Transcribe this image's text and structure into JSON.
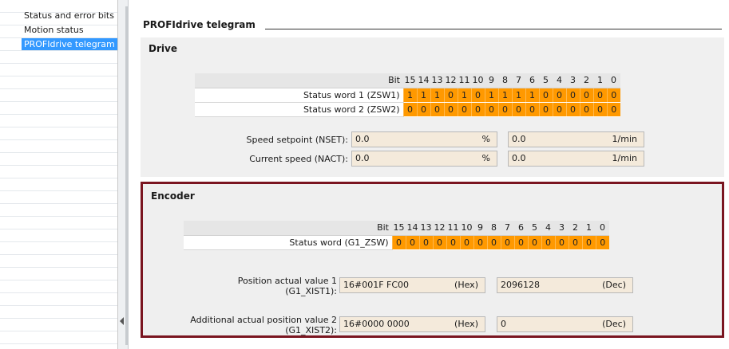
{
  "nav": {
    "items": [
      {
        "label": "Status and error bits",
        "selected": false
      },
      {
        "label": "Motion status",
        "selected": false
      },
      {
        "label": "PROFIdrive telegram",
        "selected": true
      }
    ]
  },
  "page": {
    "title": "PROFIdrive telegram"
  },
  "drive": {
    "title": "Drive",
    "bit_header_label": "Bit",
    "bit_numbers": [
      "15",
      "14",
      "13",
      "12",
      "11",
      "10",
      "9",
      "8",
      "7",
      "6",
      "5",
      "4",
      "3",
      "2",
      "1",
      "0"
    ],
    "rows": [
      {
        "label": "Status word 1 (ZSW1)",
        "bits": [
          "1",
          "1",
          "1",
          "0",
          "1",
          "0",
          "1",
          "1",
          "1",
          "1",
          "0",
          "0",
          "0",
          "0",
          "0",
          "0"
        ]
      },
      {
        "label": "Status word 2 (ZSW2)",
        "bits": [
          "0",
          "0",
          "0",
          "0",
          "0",
          "0",
          "0",
          "0",
          "0",
          "0",
          "0",
          "0",
          "0",
          "0",
          "0",
          "0"
        ]
      }
    ],
    "speed_setpoint": {
      "label": "Speed setpoint (NSET):",
      "percent_value": "0.0",
      "percent_unit": "%",
      "rpm_value": "0.0",
      "rpm_unit": "1/min"
    },
    "current_speed": {
      "label": "Current speed (NACT):",
      "percent_value": "0.0",
      "percent_unit": "%",
      "rpm_value": "0.0",
      "rpm_unit": "1/min"
    }
  },
  "encoder": {
    "title": "Encoder",
    "bit_header_label": "Bit",
    "bit_numbers": [
      "15",
      "14",
      "13",
      "12",
      "11",
      "10",
      "9",
      "8",
      "7",
      "6",
      "5",
      "4",
      "3",
      "2",
      "1",
      "0"
    ],
    "rows": [
      {
        "label": "Status word (G1_ZSW)",
        "bits": [
          "0",
          "0",
          "0",
          "0",
          "0",
          "0",
          "0",
          "0",
          "0",
          "0",
          "0",
          "0",
          "0",
          "0",
          "0",
          "0"
        ]
      }
    ],
    "position_actual": {
      "label_line1": "Position actual value 1",
      "label_line2": "(G1_XIST1):",
      "hex_value": "16#001F FC00",
      "hex_unit": "(Hex)",
      "dec_value": "2096128",
      "dec_unit": "(Dec)"
    },
    "additional_position": {
      "label_line1": "Additional actual position value 2",
      "label_line2": "(G1_XIST2):",
      "hex_value": "16#0000 0000",
      "hex_unit": "(Hex)",
      "dec_value": "0",
      "dec_unit": "(Dec)"
    }
  },
  "colors": {
    "bit_fill": "#ff9900",
    "field_fill": "#f4eadb",
    "encoder_border": "#7a1520",
    "selection": "#3399ff"
  }
}
